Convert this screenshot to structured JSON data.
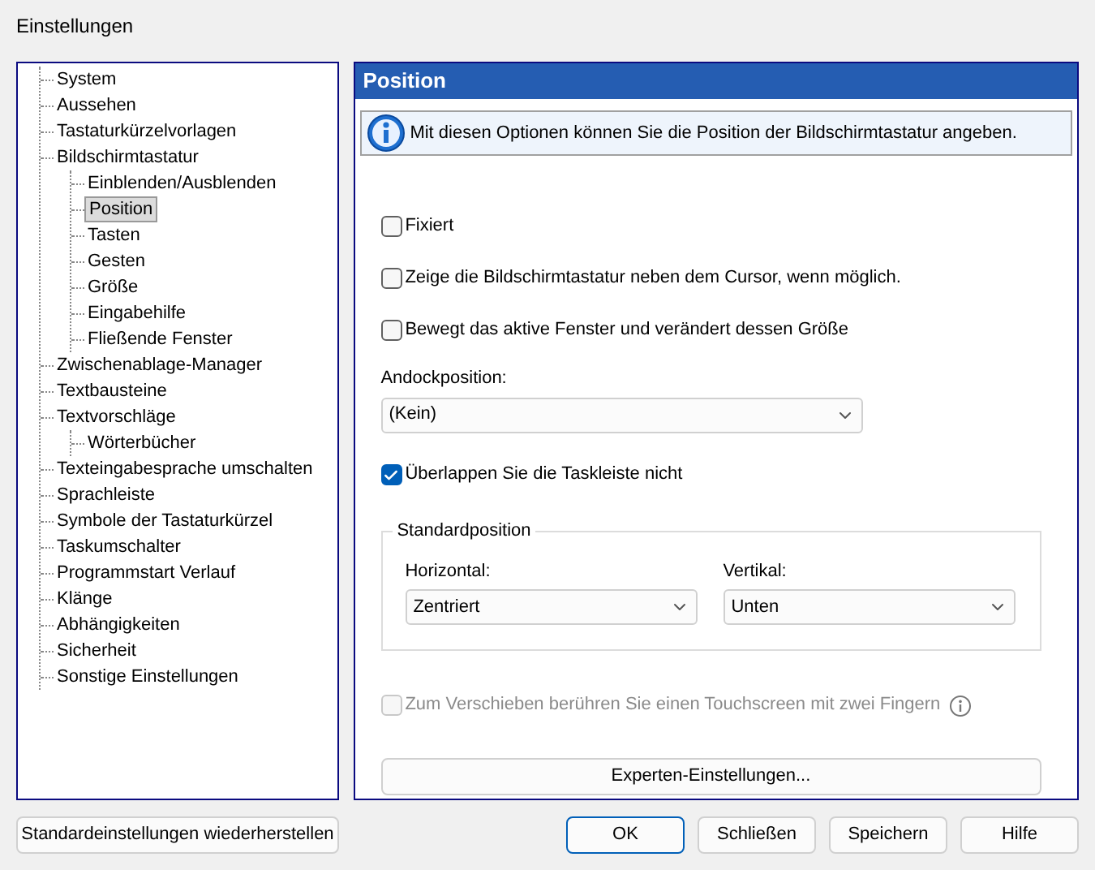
{
  "window": {
    "title": "Einstellungen"
  },
  "tree": [
    {
      "label": "System",
      "selected": false
    },
    {
      "label": "Aussehen",
      "selected": false
    },
    {
      "label": "Tastaturkürzelvorlagen",
      "selected": false
    },
    {
      "label": "Bildschirmtastatur",
      "selected": false,
      "children": [
        {
          "label": "Einblenden/Ausblenden",
          "selected": false
        },
        {
          "label": "Position",
          "selected": true
        },
        {
          "label": "Tasten",
          "selected": false
        },
        {
          "label": "Gesten",
          "selected": false
        },
        {
          "label": "Größe",
          "selected": false
        },
        {
          "label": "Eingabehilfe",
          "selected": false
        },
        {
          "label": "Fließende Fenster",
          "selected": false
        }
      ]
    },
    {
      "label": "Zwischenablage-Manager",
      "selected": false
    },
    {
      "label": "Textbausteine",
      "selected": false
    },
    {
      "label": "Textvorschläge",
      "selected": false,
      "children": [
        {
          "label": "Wörterbücher",
          "selected": false
        }
      ]
    },
    {
      "label": "Texteingabesprache umschalten",
      "selected": false
    },
    {
      "label": "Sprachleiste",
      "selected": false
    },
    {
      "label": "Symbole der Tastaturkürzel",
      "selected": false
    },
    {
      "label": "Taskumschalter",
      "selected": false
    },
    {
      "label": "Programmstart Verlauf",
      "selected": false
    },
    {
      "label": "Klänge",
      "selected": false
    },
    {
      "label": "Abhängigkeiten",
      "selected": false
    },
    {
      "label": "Sicherheit",
      "selected": false
    },
    {
      "label": "Sonstige Einstellungen",
      "selected": false
    }
  ],
  "panel": {
    "title": "Position",
    "info": "Mit diesen Optionen können Sie die Position der Bildschirmtastatur angeben.",
    "options": [
      {
        "kind": "checkbox",
        "label": "Fixiert",
        "checked": false
      },
      {
        "kind": "checkbox",
        "label": "Zeige die Bildschirmtastatur neben dem Cursor, wenn möglich.",
        "checked": false
      },
      {
        "kind": "checkbox",
        "label": "Bewegt das aktive Fenster und verändert dessen Größe",
        "checked": false
      },
      {
        "kind": "select",
        "label": "Andockposition:",
        "value": "(Kein)"
      },
      {
        "kind": "checkbox",
        "label": "Überlappen Sie die Taskleiste nicht",
        "checked": true
      }
    ],
    "group": {
      "title": "Standardposition",
      "selects": [
        {
          "label": "Horizontal:",
          "value": "Zentriert"
        },
        {
          "label": "Vertikal:",
          "value": "Unten"
        }
      ]
    },
    "touch": {
      "label": "Zum Verschieben berühren Sie einen Touchscreen mit zwei Fingern",
      "checked": false,
      "disabled": true
    },
    "expert_button": "Experten-Einstellungen..."
  },
  "restore_button": "Standardeinstellungen wiederherstellen",
  "buttons": [
    {
      "label": "OK",
      "default": true
    },
    {
      "label": "Schließen",
      "default": false
    },
    {
      "label": "Speichern",
      "default": false
    },
    {
      "label": "Hilfe",
      "default": false
    }
  ]
}
